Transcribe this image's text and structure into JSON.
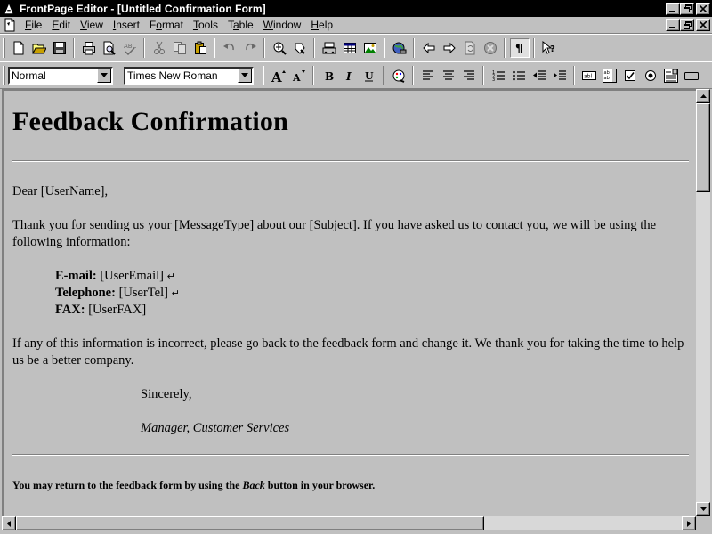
{
  "window": {
    "title": "FrontPage Editor - [Untitled Confirmation Form]"
  },
  "menu": {
    "items": [
      {
        "label": "File",
        "key": "F",
        "rest": "ile"
      },
      {
        "label": "Edit",
        "key": "E",
        "rest": "dit"
      },
      {
        "label": "View",
        "key": "V",
        "rest": "iew"
      },
      {
        "label": "Insert",
        "key": "I",
        "rest": "nsert"
      },
      {
        "label": "Format",
        "key": "o",
        "pre": "F",
        "rest": "rmat"
      },
      {
        "label": "Tools",
        "key": "T",
        "rest": "ools"
      },
      {
        "label": "Table",
        "key": "a",
        "pre": "T",
        "rest": "ble"
      },
      {
        "label": "Window",
        "key": "W",
        "rest": "indow"
      },
      {
        "label": "Help",
        "key": "H",
        "rest": "elp"
      }
    ]
  },
  "format_toolbar": {
    "style_value": "Normal",
    "font_value": "Times New Roman"
  },
  "document": {
    "heading": "Feedback Confirmation",
    "greeting": "Dear [UserName],",
    "body": "Thank you for sending us your [MessageType] about our [Subject]. If you have asked us to contact you, we will be using the following information:",
    "email_label": "E-mail:",
    "email_value": "[UserEmail]",
    "tel_label": "Telephone:",
    "tel_value": "[UserTel]",
    "fax_label": "FAX:",
    "fax_value": "[UserFAX]",
    "line_break_mark": "↵",
    "incorrect": "If any of this information is incorrect, please go back to the feedback form and change it. We thank you for taking the time to help us be a better company.",
    "closing": "Sincerely,",
    "signature": "Manager, Customer Services",
    "footer_pre": "You may return to the feedback form by using the ",
    "footer_em": "Back",
    "footer_post": " button in your browser."
  },
  "scroll": {
    "vertical_position": 0.0,
    "horizontal_position": 0.0
  }
}
